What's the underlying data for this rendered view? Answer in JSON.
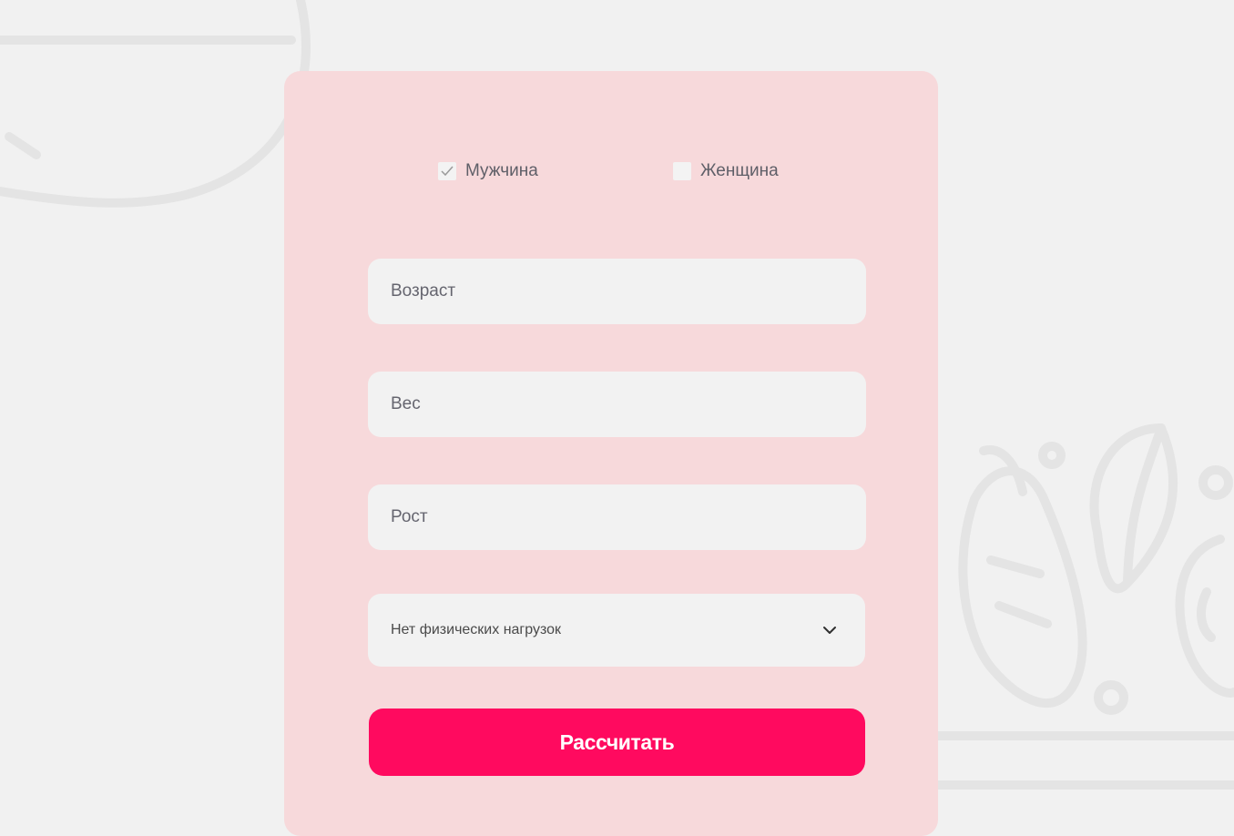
{
  "gender": {
    "male_label": "Мужчина",
    "female_label": "Женщина"
  },
  "fields": {
    "age_placeholder": "Возраст",
    "weight_placeholder": "Вес",
    "height_placeholder": "Рост"
  },
  "activity": {
    "selected": "Нет физических нагрузок"
  },
  "actions": {
    "calculate_label": "Рассчитать"
  },
  "colors": {
    "background": "#f1f1f1",
    "card": "#f7d9db",
    "field": "#f2f2f2",
    "accent": "#ff0a5f",
    "text": "#65656f"
  },
  "icons": {
    "male_checkbox_state": "checked",
    "female_checkbox_state": "unchecked",
    "select_icon": "chevron-down-icon"
  }
}
